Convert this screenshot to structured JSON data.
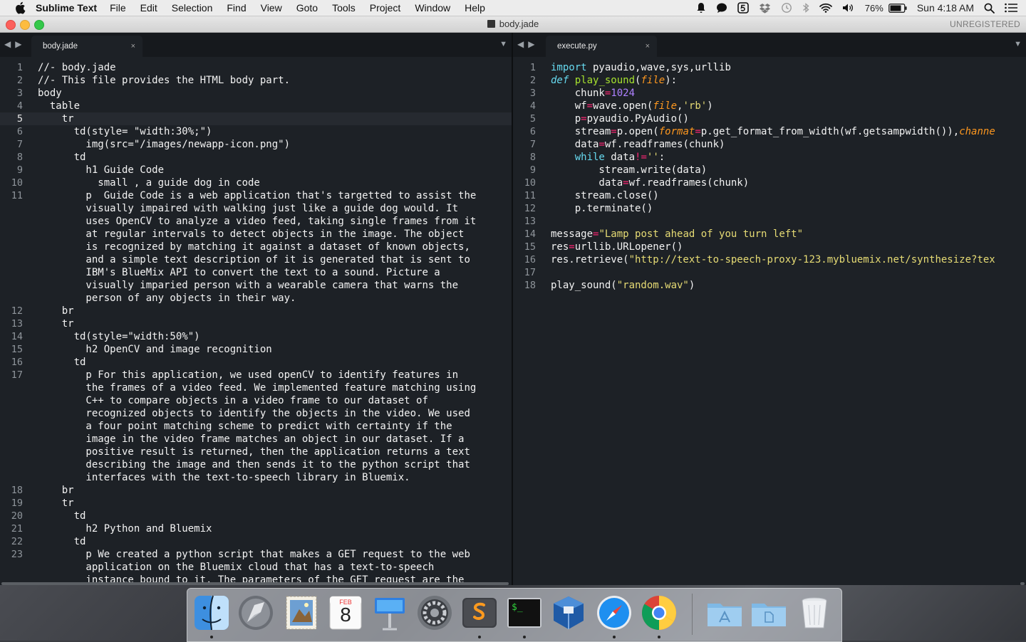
{
  "menubar": {
    "app_name": "Sublime Text",
    "items": [
      "File",
      "Edit",
      "Selection",
      "Find",
      "View",
      "Goto",
      "Tools",
      "Project",
      "Window",
      "Help"
    ],
    "battery": "76%",
    "clock": "Sun 4:18 AM"
  },
  "window": {
    "title": "body.jade",
    "registration": "UNREGISTERED"
  },
  "left_pane": {
    "tab_label": "body.jade",
    "tab_close": "×",
    "gutter": [
      "1",
      "2",
      "3",
      "4",
      "5",
      "6",
      "7",
      "8",
      "9",
      "10",
      "11",
      "",
      "",
      "",
      "",
      "",
      "",
      "",
      "",
      "12",
      "13",
      "14",
      "15",
      "16",
      "17",
      "",
      "",
      "",
      "",
      "",
      "",
      "",
      "",
      "18",
      "19",
      "20",
      "21",
      "22",
      "23",
      "",
      ""
    ],
    "current_line_index": 4,
    "lines": [
      "//- body.jade",
      "//- This file provides the HTML body part.",
      "body",
      "  table",
      "    tr",
      "      td(style= \"width:30%;\")",
      "        img(src=\"/images/newapp-icon.png\")",
      "      td",
      "        h1 Guide Code",
      "          small , a guide dog in code",
      "        p  Guide Code is a web application that's targetted to assist the",
      "        visually impaired with walking just like a guide dog would. It",
      "        uses OpenCV to analyze a video feed, taking single frames from it",
      "        at regular intervals to detect objects in the image. The object",
      "        is recognized by matching it against a dataset of known objects,",
      "        and a simple text description of it is generated that is sent to",
      "        IBM's BlueMix API to convert the text to a sound. Picture a",
      "        visually imparied person with a wearable camera that warns the",
      "        person of any objects in their way.",
      "    br",
      "    tr",
      "      td(style=\"width:50%\")",
      "        h2 OpenCV and image recognition",
      "      td",
      "        p For this application, we used openCV to identify features in",
      "        the frames of a video feed. We implemented feature matching using",
      "        C++ to compare objects in a video frame to our dataset of",
      "        recognized objects to identify the objects in the video. We used",
      "        a four point matching scheme to predict with certainty if the",
      "        image in the video frame matches an object in our dataset. If a",
      "        positive result is returned, then the application returns a text",
      "        describing the image and then sends it to the python script that",
      "        interfaces with the text-to-speech library in Bluemix.",
      "    br",
      "    tr",
      "      td",
      "        h2 Python and Bluemix",
      "      td",
      "        p We created a python script that makes a GET request to the web",
      "        application on the Bluemix cloud that has a text-to-speech",
      "        instance bound to it. The parameters of the GET request are the"
    ]
  },
  "right_pane": {
    "tab_label": "execute.py",
    "tab_close": "×",
    "gutter": [
      "1",
      "2",
      "3",
      "4",
      "5",
      "6",
      "7",
      "8",
      "9",
      "10",
      "11",
      "12",
      "13",
      "14",
      "15",
      "16",
      "17",
      "18"
    ],
    "lines": [
      [
        {
          "c": "kw",
          "t": "import"
        },
        {
          "c": "plain",
          "t": " pyaudio,wave,sys,urllib"
        }
      ],
      [
        {
          "c": "kw-i",
          "t": "def"
        },
        {
          "c": "plain",
          "t": " "
        },
        {
          "c": "fn",
          "t": "play_sound"
        },
        {
          "c": "plain",
          "t": "("
        },
        {
          "c": "arg",
          "t": "file"
        },
        {
          "c": "plain",
          "t": "):"
        }
      ],
      [
        {
          "c": "plain",
          "t": "    chunk"
        },
        {
          "c": "op",
          "t": "="
        },
        {
          "c": "num",
          "t": "1024"
        }
      ],
      [
        {
          "c": "plain",
          "t": "    wf"
        },
        {
          "c": "op",
          "t": "="
        },
        {
          "c": "plain",
          "t": "wave.open("
        },
        {
          "c": "arg",
          "t": "file"
        },
        {
          "c": "plain",
          "t": ","
        },
        {
          "c": "str",
          "t": "'rb'"
        },
        {
          "c": "plain",
          "t": ")"
        }
      ],
      [
        {
          "c": "plain",
          "t": "    p"
        },
        {
          "c": "op",
          "t": "="
        },
        {
          "c": "plain",
          "t": "pyaudio.PyAudio()"
        }
      ],
      [
        {
          "c": "plain",
          "t": "    stream"
        },
        {
          "c": "op",
          "t": "="
        },
        {
          "c": "plain",
          "t": "p.open("
        },
        {
          "c": "arg",
          "t": "format"
        },
        {
          "c": "op",
          "t": "="
        },
        {
          "c": "plain",
          "t": "p.get_format_from_width(wf.getsampwidth()),"
        },
        {
          "c": "arg",
          "t": "channe"
        }
      ],
      [
        {
          "c": "plain",
          "t": "    data"
        },
        {
          "c": "op",
          "t": "="
        },
        {
          "c": "plain",
          "t": "wf.readframes(chunk)"
        }
      ],
      [
        {
          "c": "plain",
          "t": "    "
        },
        {
          "c": "kw",
          "t": "while"
        },
        {
          "c": "plain",
          "t": " data"
        },
        {
          "c": "op",
          "t": "!="
        },
        {
          "c": "str",
          "t": "''"
        },
        {
          "c": "plain",
          "t": ":"
        }
      ],
      [
        {
          "c": "plain",
          "t": "        stream.write(data)"
        }
      ],
      [
        {
          "c": "plain",
          "t": "        data"
        },
        {
          "c": "op",
          "t": "="
        },
        {
          "c": "plain",
          "t": "wf.readframes(chunk)"
        }
      ],
      [
        {
          "c": "plain",
          "t": "    stream.close()"
        }
      ],
      [
        {
          "c": "plain",
          "t": "    p.terminate()"
        }
      ],
      [
        {
          "c": "plain",
          "t": ""
        }
      ],
      [
        {
          "c": "plain",
          "t": "message"
        },
        {
          "c": "op",
          "t": "="
        },
        {
          "c": "str",
          "t": "\"Lamp post ahead of you turn left\""
        }
      ],
      [
        {
          "c": "plain",
          "t": "res"
        },
        {
          "c": "op",
          "t": "="
        },
        {
          "c": "plain",
          "t": "urllib.URLopener()"
        }
      ],
      [
        {
          "c": "plain",
          "t": "res.retrieve("
        },
        {
          "c": "str",
          "t": "\"http://text-to-speech-proxy-123.mybluemix.net/synthesize?tex"
        }
      ],
      [
        {
          "c": "plain",
          "t": ""
        }
      ],
      [
        {
          "c": "plain",
          "t": "play_sound("
        },
        {
          "c": "str",
          "t": "\"random.wav\""
        },
        {
          "c": "plain",
          "t": ")"
        }
      ]
    ]
  },
  "dock": {
    "apps": [
      "finder-icon",
      "launchpad-icon",
      "mail-stamp-icon",
      "calendar-icon",
      "keynote-icon",
      "system-preferences-icon",
      "sublime-text-icon",
      "terminal-icon",
      "virtualbox-icon",
      "safari-icon",
      "chrome-icon",
      "applications-folder-icon",
      "documents-folder-icon",
      "trash-icon"
    ],
    "calendar_month": "FEB",
    "calendar_day": "8",
    "terminal_prompt": "$_"
  }
}
